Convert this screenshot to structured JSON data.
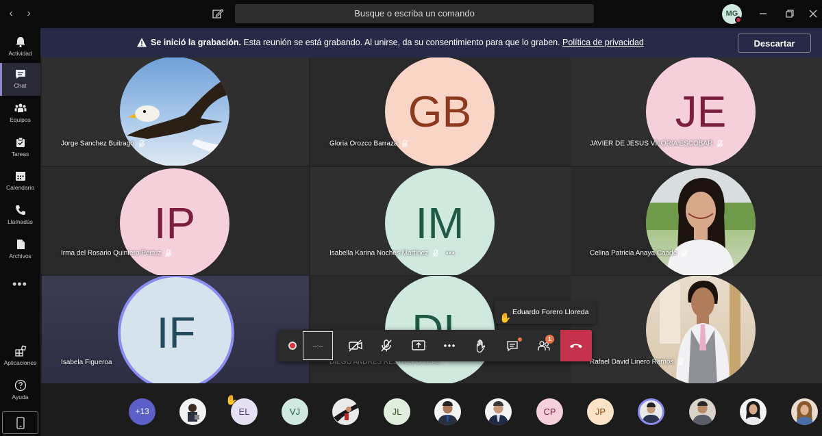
{
  "topbar": {
    "search_placeholder": "Busque o escriba un comando",
    "me_initials": "MG"
  },
  "sidebar": {
    "items": [
      {
        "label": "Actividad",
        "icon": "bell-icon"
      },
      {
        "label": "Chat",
        "icon": "chat-icon",
        "active": true
      },
      {
        "label": "Equipos",
        "icon": "teams-icon"
      },
      {
        "label": "Tareas",
        "icon": "tasks-icon"
      },
      {
        "label": "Calendario",
        "icon": "calendar-icon"
      },
      {
        "label": "Llamadas",
        "icon": "phone-icon"
      },
      {
        "label": "Archivos",
        "icon": "files-icon"
      }
    ],
    "more": "•••",
    "apps_label": "Aplicaciones",
    "help_label": "Ayuda"
  },
  "banner": {
    "title": "Se inició la grabación.",
    "message": " Esta reunión se está grabando. Al unirse, da su consentimiento para que lo graben. ",
    "link": "Política de privacidad",
    "dismiss": "Descartar"
  },
  "participants": [
    {
      "name": "Jorge Sanchez Buitrago",
      "initials": "",
      "photo": "eagle"
    },
    {
      "name": "Gloria Orozco Barraza",
      "initials": "GB",
      "bg": "#f9d5c7",
      "fg": "#8b3a1e"
    },
    {
      "name": "JAVIER DE JESUS VILORIA ESCOBAR",
      "initials": "JE",
      "bg": "#f5d0db",
      "fg": "#7a1f3f"
    },
    {
      "name": "Irma del Rosario Quintero Pertuz",
      "initials": "IP",
      "bg": "#f5d0db",
      "fg": "#7a1f3f"
    },
    {
      "name": "Isabella Karina Noches Martinez",
      "initials": "IM",
      "bg": "#cfe9df",
      "fg": "#1e5a44",
      "more": "•••"
    },
    {
      "name": "Celina Patricia Anaya Caade",
      "initials": "",
      "photo": "woman"
    },
    {
      "name": "Isabela Figueroa",
      "initials": "IF",
      "bg": "#d6e3ec",
      "fg": "#244a5e"
    },
    {
      "name": "DIEGO ANDRES RESTREPO LEAL",
      "initials": "DL",
      "bg": "#cfe9df",
      "fg": "#1e5a44"
    },
    {
      "name": "Rafael David Linero Ramos",
      "initials": "",
      "photo": "man"
    }
  ],
  "controls": {
    "timer": "--:--",
    "participants_badge": "1"
  },
  "hand_tooltip": {
    "name": "Eduardo Forero Lloreda",
    "icon": "✋"
  },
  "strip": {
    "overflow": "+13",
    "people": [
      {
        "initials": "",
        "photo": true
      },
      {
        "initials": "EL",
        "bg": "#e6e0f3",
        "fg": "#4b3b7a",
        "hand": "✋"
      },
      {
        "initials": "VJ",
        "bg": "#cfe9df",
        "fg": "#1e5a44"
      },
      {
        "initials": "",
        "photo": true
      },
      {
        "initials": "JL",
        "bg": "#dfeedd",
        "fg": "#3a5a2a"
      },
      {
        "initials": "",
        "photo": true
      },
      {
        "initials": "",
        "photo": true
      },
      {
        "initials": "CP",
        "bg": "#f5d0db",
        "fg": "#7a1f3f"
      },
      {
        "initials": "JP",
        "bg": "#fbe3c8",
        "fg": "#8a4a12"
      },
      {
        "initials": "",
        "photo": true
      },
      {
        "initials": "",
        "photo": true
      },
      {
        "initials": "",
        "photo": true
      },
      {
        "initials": "",
        "photo": true
      }
    ]
  }
}
